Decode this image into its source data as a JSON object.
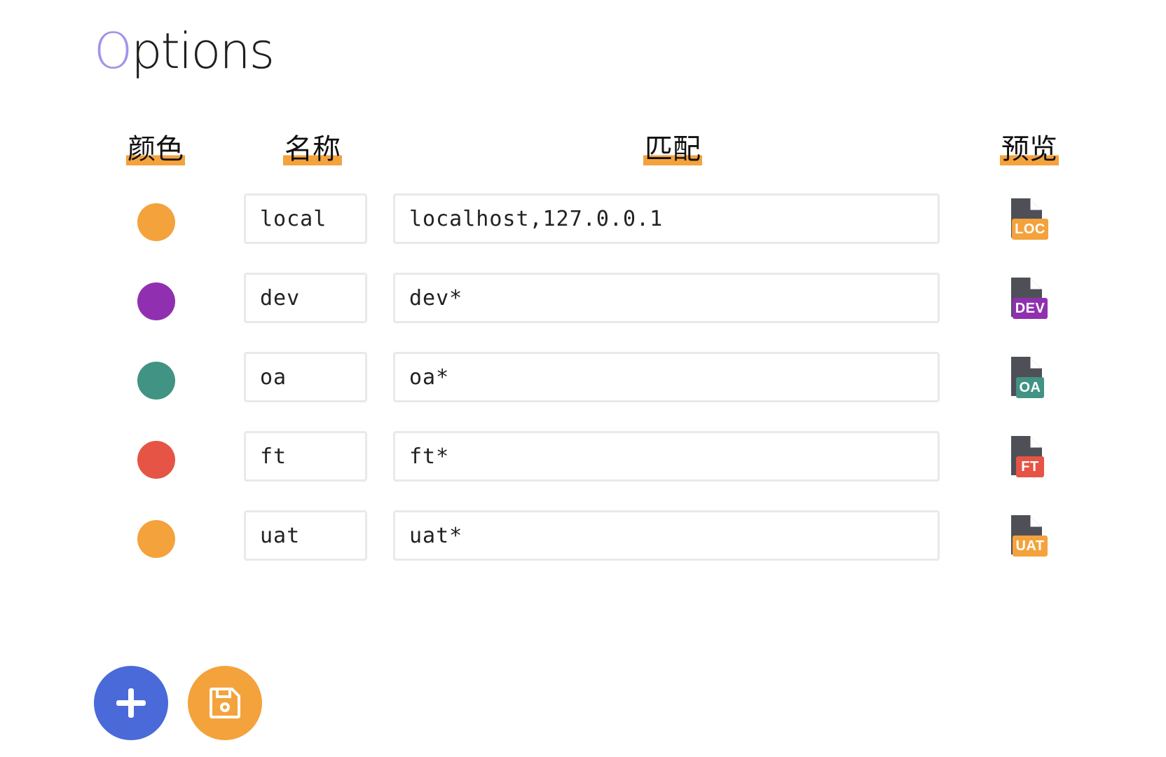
{
  "page": {
    "title_first": "O",
    "title_rest": "ptions"
  },
  "headers": {
    "color": "颜色",
    "name": "名称",
    "match": "匹配",
    "preview": "预览"
  },
  "rows": [
    {
      "color": "#f4a23c",
      "name": "local",
      "match": "localhost,127.0.0.1",
      "badge": "LOC"
    },
    {
      "color": "#9030b0",
      "name": "dev",
      "match": "dev*",
      "badge": "DEV"
    },
    {
      "color": "#419383",
      "name": "oa",
      "match": "oa*",
      "badge": "OA"
    },
    {
      "color": "#e55445",
      "name": "ft",
      "match": "ft*",
      "badge": "FT"
    },
    {
      "color": "#f4a23c",
      "name": "uat",
      "match": "uat*",
      "badge": "UAT"
    }
  ],
  "actions": {
    "add_icon": "plus-icon",
    "save_icon": "floppy-disk-icon"
  },
  "colors": {
    "accent": "#f4a23c",
    "add_button": "#4a6ad9",
    "save_button": "#f4a23c",
    "title_accent": "#a294e8",
    "doc_icon": "#4f5057"
  }
}
